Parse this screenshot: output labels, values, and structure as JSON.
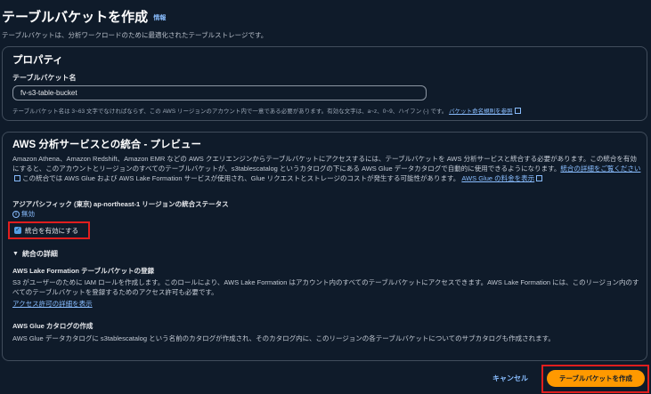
{
  "header": {
    "title": "テーブルバケットを作成",
    "info": "情報",
    "subtitle": "テーブルバケットは、分析ワークロードのために最適化されたテーブルストレージです。"
  },
  "properties": {
    "title": "プロパティ",
    "name_label": "テーブルバケット名",
    "name_value": "fv-s3-table-bucket",
    "hint": "テーブルバケット名は 3~63 文字でなければならず、この AWS リージョンのアカウント内で一意である必要があります。有効な文字は、a~z、0~9、ハイフン (-) です。",
    "hint_link": "バケット命名規則を参照"
  },
  "integration": {
    "title": "AWS 分析サービスとの統合 - プレビュー",
    "desc_1": "Amazon Athena、Amazon Redshift、Amazon EMR などの AWS クエリエンジンからテーブルバケットにアクセスするには、テーブルバケットを AWS 分析サービスと統合する必要があります。この統合を有効にすると、このアカウントとリージョンのすべてのテーブルバケットが、s3tablescatalog というカタログの下にある AWS Glue データカタログで自動的に使用できるようになります。",
    "desc_link_1": "統合の詳細をご覧ください",
    "desc_2": "この統合では AWS Glue および AWS Lake Formation サービスが使用され、Glue リクエストとストレージのコストが発生する可能性があります。",
    "desc_link_2": "AWS Glue の料金を表示",
    "region_status": "アジアパシフィック (東京) ap-northeast-1 リージョンの統合ステータス",
    "status_value": "無効",
    "checkbox_label": "統合を有効にする",
    "details_toggle": "統合の詳細",
    "lake_title": "AWS Lake Formation テーブルバケットの登録",
    "lake_desc": "S3 がユーザーのために IAM ロールを作成します。このロールにより、AWS Lake Formation はアカウント内のすべてのテーブルバケットにアクセスできます。AWS Lake Formation には、このリージョン内のすべてのテーブルバケットを登録するためのアクセス許可も必要です。",
    "lake_link": "アクセス許可の詳細を表示",
    "glue_title": "AWS Glue カタログの作成",
    "glue_desc": "AWS Glue データカタログに s3tablescatalog という名前のカタログが作成され、そのカタログ内に、このリージョンの各テーブルバケットについてのサブカタログも作成されます。"
  },
  "footer": {
    "cancel": "キャンセル",
    "submit": "テーブルバケットを作成"
  },
  "colors": {
    "background": "#0f1b2a",
    "accent": "#ff9900",
    "link": "#89bdff",
    "highlight": "#e01e1e"
  }
}
